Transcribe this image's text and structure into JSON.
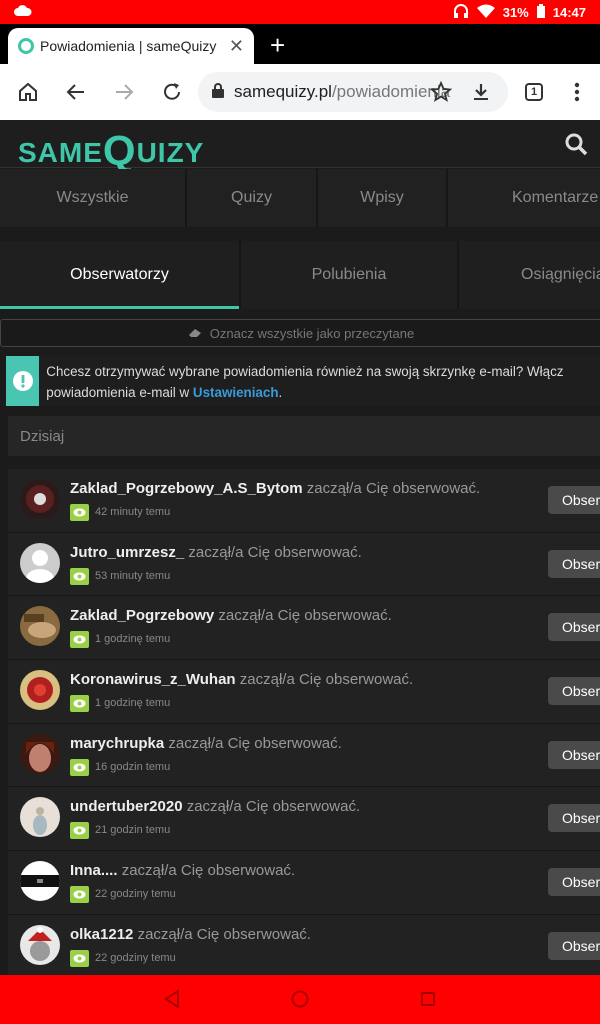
{
  "status_bar": {
    "battery": "31%",
    "time": "14:47"
  },
  "browser": {
    "tab_title": "Powiadomienia | sameQuizy",
    "url_host": "samequizy.pl",
    "url_path": "/powiadomienia",
    "tab_count": "1"
  },
  "site": {
    "logo_small": "SAME",
    "logo_big": "Q",
    "logo_rest": "UIZY"
  },
  "filters": [
    "Wszystkie",
    "Quizy",
    "Wpisy",
    "Komentarze"
  ],
  "subtabs": [
    "Obserwatorzy",
    "Polubienia",
    "Osiągnięcia"
  ],
  "mark_all_read": "Oznacz wszystkie jako przeczytane",
  "notice": {
    "text": "Chcesz otrzymywać wybrane powiadomienia również na swoją skrzynkę e-mail? Włącz powiadomienia e-mail w",
    "link": "Ustawieniach",
    "end": "."
  },
  "day_label": "Dzisiaj",
  "action_text": "zaczął/a Cię obserwować.",
  "follow_label": "Obserwuj",
  "notifications": [
    {
      "user": "Zaklad_Pogrzebowy_A.S_Bytom",
      "time": "42 minuty temu"
    },
    {
      "user": "Jutro_umrzesz_",
      "time": "53 minuty temu"
    },
    {
      "user": "Zaklad_Pogrzebowy",
      "time": "1 godzinę temu"
    },
    {
      "user": "Koronawirus_z_Wuhan",
      "time": "1 godzinę temu"
    },
    {
      "user": "marychrupka",
      "time": "16 godzin temu"
    },
    {
      "user": "undertuber2020",
      "time": "21 godzin temu"
    },
    {
      "user": "Inna....",
      "time": "22 godziny temu"
    },
    {
      "user": "olka1212",
      "time": "22 godziny temu"
    }
  ],
  "colors": {
    "accent": "#3fc6a8",
    "status_bar": "#ff0000",
    "eye_badge": "#9ad049"
  }
}
